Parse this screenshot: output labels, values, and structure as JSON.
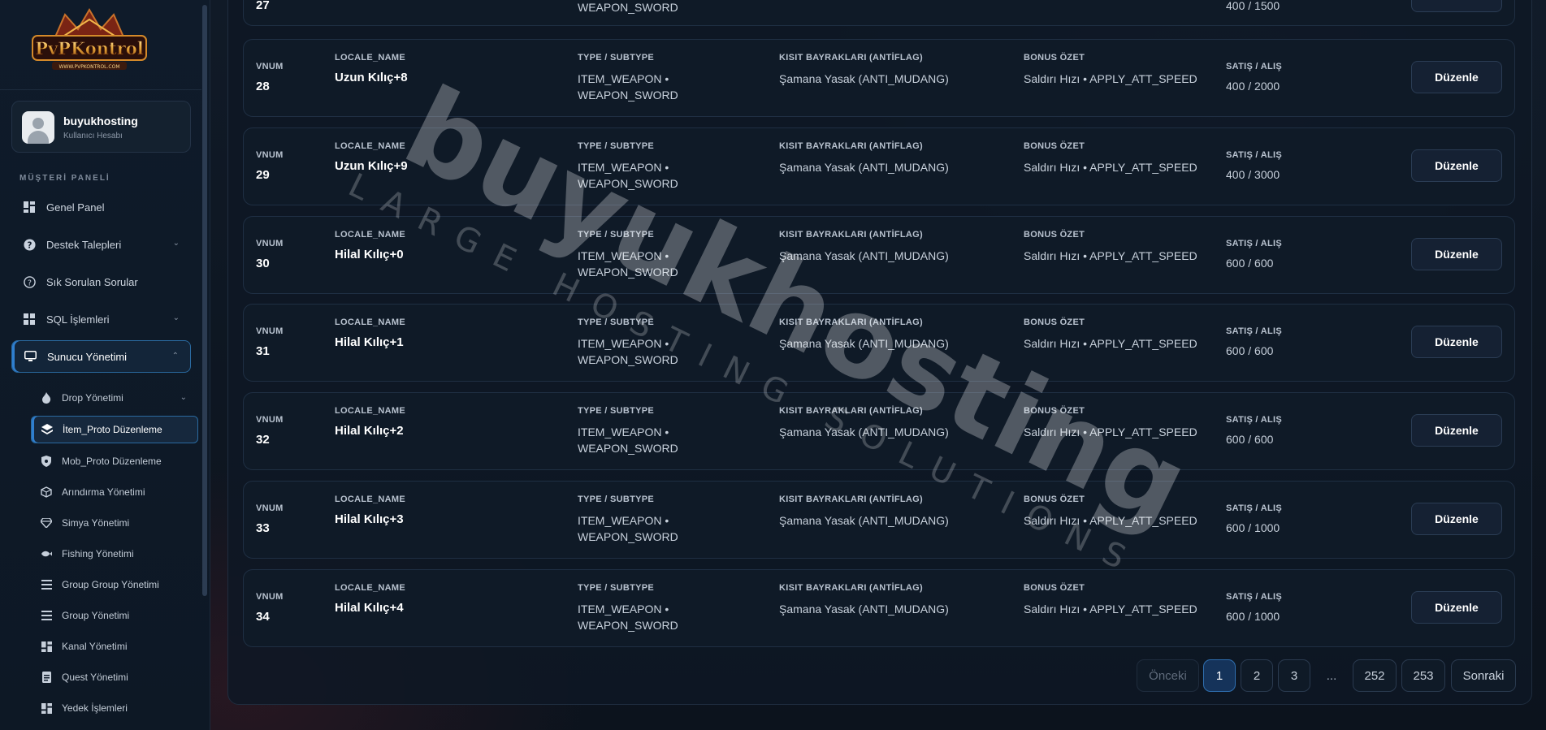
{
  "sidebar": {
    "brand": "PvPKontrol",
    "brand_sub": "WWW.PVPKONTROL.COM",
    "user": {
      "name": "buyukhosting",
      "role": "Kullanıcı Hesabı"
    },
    "section_title": "MÜŞTERİ PANELİ",
    "items": [
      {
        "label": "Genel Panel",
        "icon": "dashboard-icon"
      },
      {
        "label": "Destek Talepleri",
        "icon": "help-icon"
      },
      {
        "label": "Sık Sorulan Sorular",
        "icon": "question-icon"
      },
      {
        "label": "SQL İşlemleri",
        "icon": "grid-icon"
      },
      {
        "label": "Sunucu Yönetimi",
        "icon": "monitor-icon"
      }
    ],
    "sub_items": [
      {
        "label": "Drop Yönetimi",
        "icon": "flame-icon"
      },
      {
        "label": "İtem_Proto Düzenleme",
        "icon": "layers-icon"
      },
      {
        "label": "Mob_Proto Düzenleme",
        "icon": "shield-icon"
      },
      {
        "label": "Arındırma Yönetimi",
        "icon": "cube-icon"
      },
      {
        "label": "Simya Yönetimi",
        "icon": "gem-icon"
      },
      {
        "label": "Fishing Yönetimi",
        "icon": "fish-icon"
      },
      {
        "label": "Group Group Yönetimi",
        "icon": "list-icon"
      },
      {
        "label": "Group Yönetimi",
        "icon": "list-icon"
      },
      {
        "label": "Kanal Yönetimi",
        "icon": "grid-icon"
      },
      {
        "label": "Quest Yönetimi",
        "icon": "document-icon"
      },
      {
        "label": "Yedek İşlemleri",
        "icon": "grid-icon"
      }
    ]
  },
  "labels": {
    "vnum": "VNUM",
    "locale_name": "LOCALE_NAME",
    "type": "TYPE / SUBTYPE",
    "antiflag": "KISIT BAYRAKLARI (ANTİFLAG)",
    "bonus": "BONUS ÖZET",
    "price": "SATIŞ / ALIŞ",
    "edit": "Düzenle"
  },
  "partial_row": {
    "type_line2": "WEAPON_SWORD",
    "vnum": "27",
    "price": "400 / 1500"
  },
  "rows": [
    {
      "vnum": "28",
      "name": "Uzun Kılıç+8",
      "type1": "ITEM_WEAPON •",
      "type2": "WEAPON_SWORD",
      "antiflag": "Şamana Yasak (ANTI_MUDANG)",
      "bonus": "Saldırı Hızı • APPLY_ATT_SPEED",
      "price": "400 / 2000"
    },
    {
      "vnum": "29",
      "name": "Uzun Kılıç+9",
      "type1": "ITEM_WEAPON •",
      "type2": "WEAPON_SWORD",
      "antiflag": "Şamana Yasak (ANTI_MUDANG)",
      "bonus": "Saldırı Hızı • APPLY_ATT_SPEED",
      "price": "400 / 3000"
    },
    {
      "vnum": "30",
      "name": "Hilal Kılıç+0",
      "type1": "ITEM_WEAPON •",
      "type2": "WEAPON_SWORD",
      "antiflag": "Şamana Yasak (ANTI_MUDANG)",
      "bonus": "Saldırı Hızı • APPLY_ATT_SPEED",
      "price": "600 / 600"
    },
    {
      "vnum": "31",
      "name": "Hilal Kılıç+1",
      "type1": "ITEM_WEAPON •",
      "type2": "WEAPON_SWORD",
      "antiflag": "Şamana Yasak (ANTI_MUDANG)",
      "bonus": "Saldırı Hızı • APPLY_ATT_SPEED",
      "price": "600 / 600"
    },
    {
      "vnum": "32",
      "name": "Hilal Kılıç+2",
      "type1": "ITEM_WEAPON •",
      "type2": "WEAPON_SWORD",
      "antiflag": "Şamana Yasak (ANTI_MUDANG)",
      "bonus": "Saldırı Hızı • APPLY_ATT_SPEED",
      "price": "600 / 600"
    },
    {
      "vnum": "33",
      "name": "Hilal Kılıç+3",
      "type1": "ITEM_WEAPON •",
      "type2": "WEAPON_SWORD",
      "antiflag": "Şamana Yasak (ANTI_MUDANG)",
      "bonus": "Saldırı Hızı • APPLY_ATT_SPEED",
      "price": "600 / 1000"
    },
    {
      "vnum": "34",
      "name": "Hilal Kılıç+4",
      "type1": "ITEM_WEAPON •",
      "type2": "WEAPON_SWORD",
      "antiflag": "Şamana Yasak (ANTI_MUDANG)",
      "bonus": "Saldırı Hızı • APPLY_ATT_SPEED",
      "price": "600 / 1000"
    }
  ],
  "pagination": {
    "prev": "Önceki",
    "pages": [
      "1",
      "2",
      "3",
      "...",
      "252",
      "253"
    ],
    "current": "1",
    "next": "Sonraki"
  },
  "watermark": {
    "main": "buyukhosting",
    "sub": "LARGE HOSTING SOLUTIONS"
  },
  "colors": {
    "accent": "#2f7fd0",
    "background": "#0e1622",
    "row_bg": "#0f1a27"
  }
}
